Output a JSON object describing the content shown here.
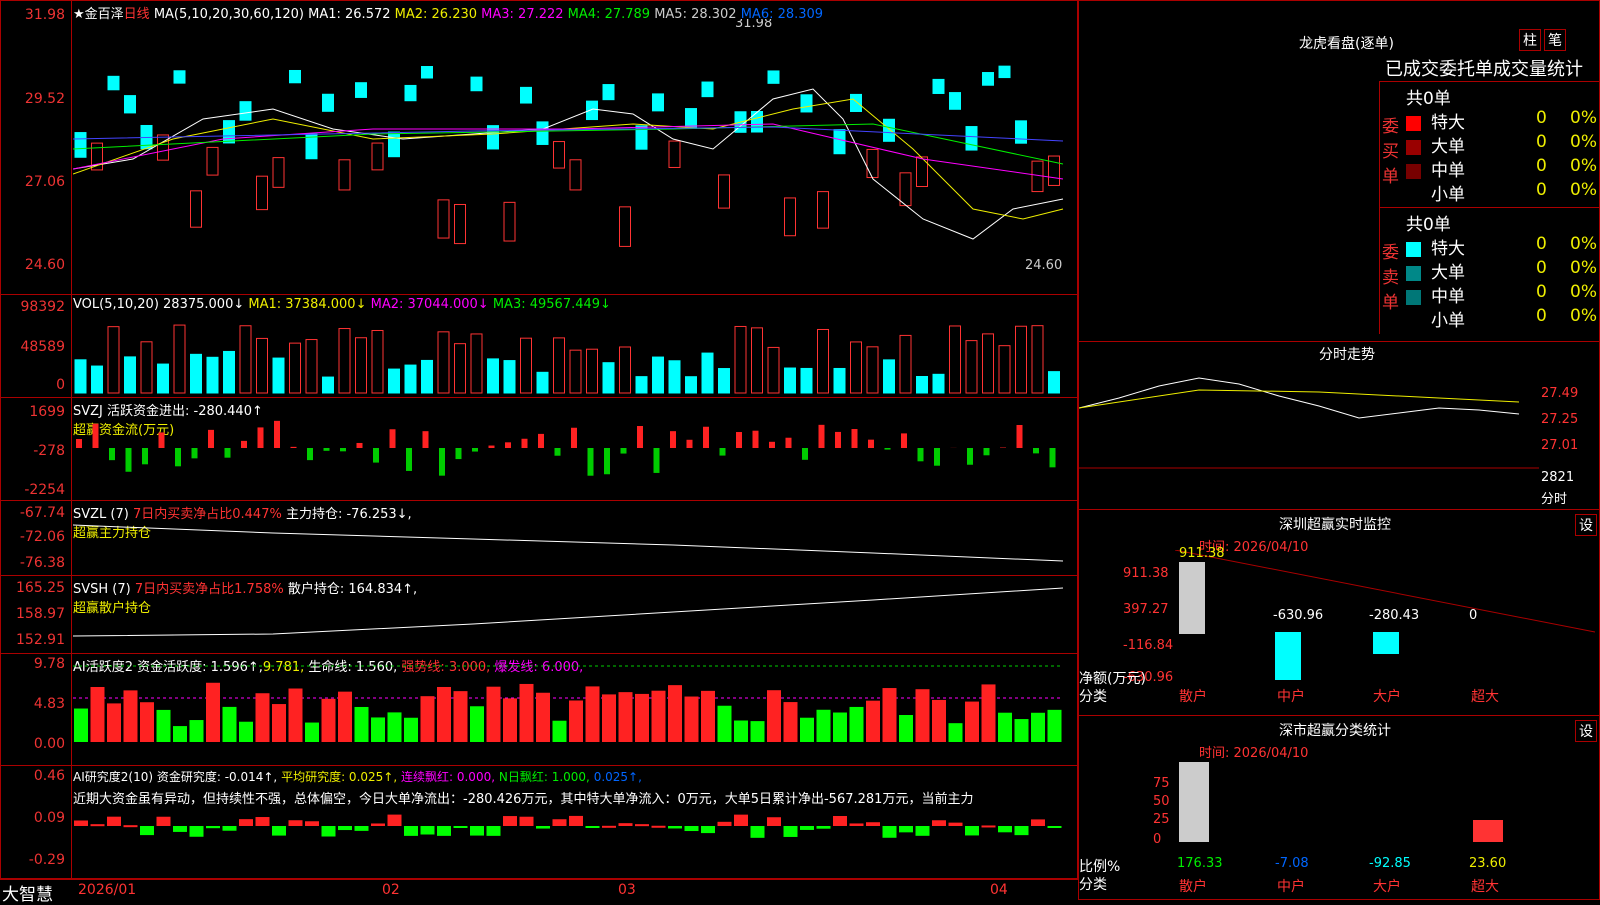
{
  "kline": {
    "title": "★金百泽",
    "period": "日线",
    "ma_head": "MA(5,10,20,30,60,120)",
    "ma": [
      {
        "t": "MA1: 26.572",
        "c": "#fff"
      },
      {
        "t": "MA2: 26.230",
        "c": "#ee0"
      },
      {
        "t": "MA3: 27.222",
        "c": "#f0f"
      },
      {
        "t": "MA4: 27.789",
        "c": "#0e0"
      },
      {
        "t": "MA5: 28.302",
        "c": "#ccc"
      },
      {
        "t": "MA6: 28.309",
        "c": "#06f"
      }
    ],
    "y": [
      "31.98",
      "29.52",
      "27.06",
      "24.60"
    ],
    "hi": "31.98",
    "lo": "24.60"
  },
  "vol": {
    "title": "VOL(5,10,20)  28375.000↓",
    "ma1": "MA1: 37384.000↓",
    "ma2": "MA2: 37044.000↓",
    "ma3": "MA3: 49567.449↓",
    "y": [
      "98392",
      "48589",
      "0"
    ]
  },
  "svzj": {
    "title": "SVZJ  活跃资金进出: -280.440↑",
    "sub": "超赢资金流(万元)",
    "y": [
      "1699",
      "-278",
      "-2254"
    ]
  },
  "svzl": {
    "t1": "SVZL (7)",
    "t2": "7日内买卖净占比0.447%",
    "t3": "主力持仓: -76.253↓,",
    "sub": "超赢主力持仓",
    "y": [
      "-67.74",
      "-72.06",
      "-76.38"
    ]
  },
  "svsh": {
    "t1": "SVSH (7)",
    "t2": "7日内买卖净占比1.758%",
    "t3": "散户持仓: 164.834↑,",
    "sub": "超赢散户持仓",
    "y": [
      "165.25",
      "158.97",
      "152.91"
    ]
  },
  "ai1": {
    "t1": "AI活跃度2 资金活跃度: 1.596↑,",
    "t2": "9.781,",
    "t3": "生命线: 1.560,",
    "t4": "强势线: 3.000,",
    "t5": "爆发线: 6.000,",
    "y": [
      "9.78",
      "4.83",
      "0.00"
    ]
  },
  "ai2": {
    "t1": "AI研究度2(10) 资金研究度: -0.014↑,",
    "t2": "平均研究度: 0.025↑,",
    "t3": "连续飘红: 0.000,",
    "t4": "N日飘红: 1.000,",
    "t5": "0.025↑,",
    "text": "近期大资金虽有异动，但持续性不强，总体偏空，今日大单净流出：-280.426万元，其中特大单净流入：0万元，大单5日累计净出-567.281万元，当前主力",
    "y": [
      "0.46",
      "0.09",
      "-0.29"
    ]
  },
  "dates": [
    "2026/01",
    "02",
    "03",
    "04"
  ],
  "logo": "大智慧",
  "right": {
    "lh_title": "龙虎看盘(逐单)",
    "btn1": "柱",
    "btn2": "笔",
    "stat_title": "已成交委托单成交量统计",
    "buy_label": "委买单",
    "sell_label": "委卖单",
    "total": "共0单",
    "rows": [
      "特大",
      "大单",
      "中单",
      "小单"
    ],
    "zero": "0",
    "pct": "0%",
    "buy_colors": [
      "#f00",
      "#900",
      "#700",
      "#000"
    ],
    "sell_colors": [
      "#0ff",
      "#088",
      "#077",
      "#000"
    ],
    "fs_title": "分时走势",
    "fs_y": [
      "27.49",
      "27.25",
      "27.01"
    ],
    "fs_vol": "2821",
    "fs_unit": "分时",
    "sz_title": "深圳超赢实时监控",
    "set": "设",
    "time1": "时间: 2026/04/10",
    "sz_y": [
      "911.38",
      "397.27",
      "-116.84",
      "-630.96"
    ],
    "sz_vals": [
      "911.38",
      "-630.96",
      "-280.43",
      "0"
    ],
    "sz_unit": "净额(万元)",
    "cat_lbl": "分类",
    "cats": [
      "散户",
      "中户",
      "大户",
      "超大"
    ],
    "cls_title": "深市超赢分类统计",
    "time2": "时间: 2026/04/10",
    "cls_y": [
      "75",
      "50",
      "25",
      "0"
    ],
    "cls_vals": [
      "176.33",
      "-7.08",
      "-92.85",
      "23.60"
    ],
    "ratio": "比例%"
  }
}
